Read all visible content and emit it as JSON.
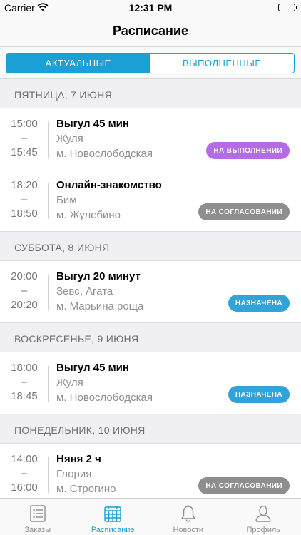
{
  "status_bar": {
    "carrier": "Carrier",
    "time": "12:31 PM"
  },
  "nav": {
    "title": "Расписание"
  },
  "segments": [
    {
      "label": "АКТУАЛЬНЫЕ",
      "active": true
    },
    {
      "label": "ВЫПОЛНЕННЫЕ",
      "active": false
    }
  ],
  "sections": [
    {
      "header": "ПЯТНИЦА, 7 ИЮНЯ",
      "items": [
        {
          "start": "15:00",
          "dash": "–",
          "end": "15:45",
          "title": "Выгул 45 мин",
          "name": "Жуля",
          "metro": "м. Новослободская",
          "status": "НА ВЫПОЛНЕНИИ",
          "status_color": "#b56be5"
        },
        {
          "start": "18:20",
          "dash": "–",
          "end": "18:50",
          "title": "Онлайн-знакомство",
          "name": "Бим",
          "metro": "м. Жулебино",
          "status": "НА СОГЛАСОВАНИИ",
          "status_color": "#8e8e8e"
        }
      ]
    },
    {
      "header": "СУББОТА, 8 ИЮНЯ",
      "items": [
        {
          "start": "20:00",
          "dash": "–",
          "end": "20:20",
          "title": "Выгул 20 минут",
          "name": "Зевс, Агата",
          "metro": "м. Марьина роща",
          "status": "НАЗНАЧЕНА",
          "status_color": "#30a3d9"
        }
      ]
    },
    {
      "header": "ВОСКРЕСЕНЬЕ, 9 ИЮНЯ",
      "items": [
        {
          "start": "18:00",
          "dash": "–",
          "end": "18:45",
          "title": "Выгул 45 мин",
          "name": "Жуля",
          "metro": "м. Новослободская",
          "status": "НАЗНАЧЕНА",
          "status_color": "#30a3d9"
        }
      ]
    },
    {
      "header": "ПОНЕДЕЛЬНИК, 10 ИЮНЯ",
      "items": [
        {
          "start": "14:00",
          "dash": "–",
          "end": "16:00",
          "title": "Няня 2 ч",
          "name": "Глория",
          "metro": "м. Строгино",
          "status": "НА СОГЛАСОВАНИИ",
          "status_color": "#8e8e8e"
        }
      ]
    }
  ],
  "tabbar": {
    "accent": "#1a9fd6",
    "tabs": [
      {
        "label": "Заказы",
        "icon": "orders-list-icon",
        "active": false
      },
      {
        "label": "Расписание",
        "icon": "calendar-icon",
        "active": true
      },
      {
        "label": "Новости",
        "icon": "bell-icon",
        "active": false
      },
      {
        "label": "Профиль",
        "icon": "profile-icon",
        "active": false
      }
    ]
  }
}
